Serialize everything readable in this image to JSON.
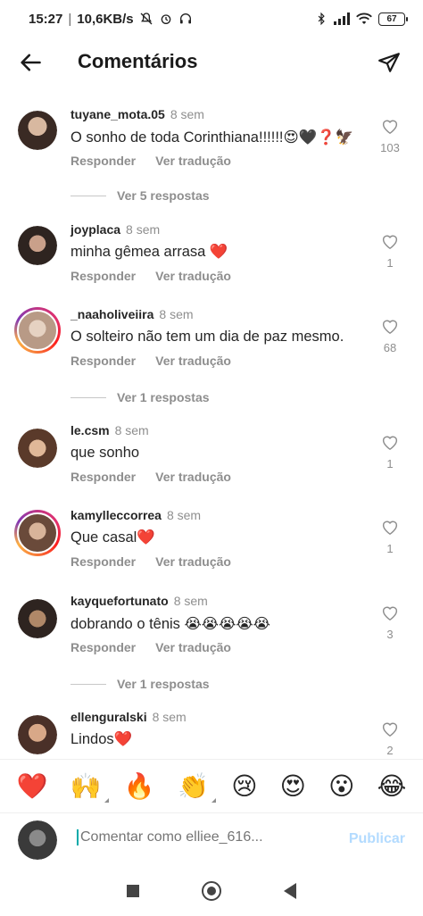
{
  "status_bar": {
    "time": "15:27",
    "speed": "10,6KB/s",
    "battery": "67"
  },
  "header": {
    "title": "Comentários"
  },
  "actions": {
    "reply": "Responder",
    "translate": "Ver tradução"
  },
  "comments": [
    {
      "user": "tuyane_mota.05",
      "time": "8 sem",
      "text": "O sonho de toda Corinthiana!!!!!!😍🖤❓🦅",
      "likes": "103",
      "avatar_color": "#3a2a24"
    },
    {
      "user": "joyplaca",
      "time": "8 sem",
      "text": "minha gêmea arrasa ❤️",
      "likes": "1",
      "avatar_color": "#4a3a36"
    },
    {
      "user": "_naaholiveiira",
      "time": "8 sem",
      "text": "O solteiro não tem um dia de paz mesmo.",
      "likes": "68",
      "avatar_color": "#bfa89a"
    },
    {
      "user": "le.csm",
      "time": "8 sem",
      "text": "que sonho",
      "likes": "1",
      "avatar_color": "#b58a6a"
    },
    {
      "user": "kamylleccorrea",
      "time": "8 sem",
      "text": "Que casal❤️",
      "likes": "1",
      "avatar_color": "#7a5a48"
    },
    {
      "user": "kayquefortunato",
      "time": "8 sem",
      "text": "dobrando o tênis 😭😭😭😭😭",
      "likes": "3",
      "avatar_color": "#4e3a2e"
    },
    {
      "user": "ellenguralski",
      "time": "8 sem",
      "text": "Lindos❤️",
      "likes": "2",
      "avatar_color": "#6a4a3e"
    }
  ],
  "replies": [
    {
      "label": "Ver 5 respostas"
    },
    {
      "label": "Ver 1 respostas"
    },
    {
      "label": "Ver 1 respostas"
    }
  ],
  "reactions": [
    "❤️",
    "🙌",
    "🔥",
    "👏",
    "😢",
    "😍",
    "😮",
    "😂"
  ],
  "composer": {
    "placeholder": "Comentar como elliee_616...",
    "publish": "Publicar",
    "avatar_color": "#3a3a3a"
  }
}
